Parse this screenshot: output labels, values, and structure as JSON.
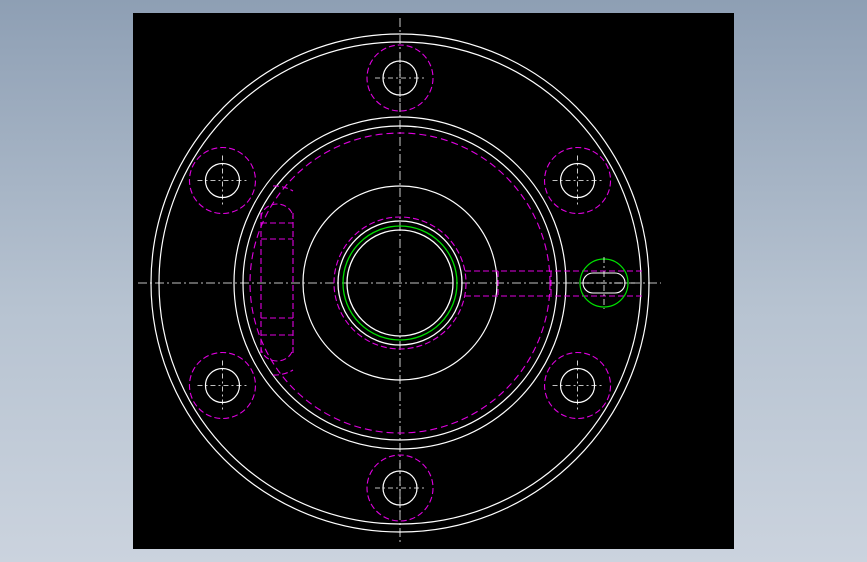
{
  "viewport": {
    "background": "#000000",
    "window_background": "#a9b6c6"
  },
  "colors": {
    "visible_edge": "#ffffff",
    "hidden_edge": "#e000e0",
    "thread_edge": "#00e000",
    "centerline": "#ffffff"
  },
  "drawing": {
    "view": "flange-front-view",
    "bolt_hole_count": 6,
    "has_keyway_slot": true,
    "has_side_pin_hole": true
  }
}
